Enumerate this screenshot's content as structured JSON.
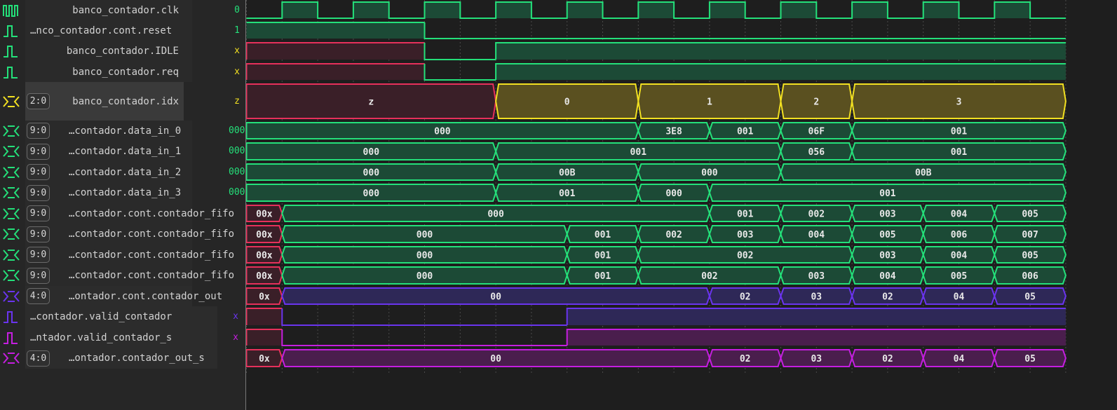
{
  "colors": {
    "green": "#24e07a",
    "green_fill": "#1c4a36",
    "red": "#e6305b",
    "red_fill": "#3a1f28",
    "yellow": "#f2e021",
    "yellow_fill": "#5a5020",
    "violet": "#6a34ee",
    "violet_fill": "#2e2857",
    "magenta": "#c51ee0",
    "magenta_fill": "#4a1e4d",
    "grid": "#4a4a4a"
  },
  "signals": [
    {
      "name": "banco_contador.clk",
      "width": "",
      "value": "0",
      "icon": "clock-icon",
      "style": "clock"
    },
    {
      "name": "…nco_contador.cont.reset",
      "width": "",
      "value": "1",
      "icon": "bit-wave-icon",
      "style": "bit"
    },
    {
      "name": "banco_contador.IDLE",
      "width": "",
      "value": "x",
      "icon": "bit-wave-icon",
      "style": "bit"
    },
    {
      "name": "banco_contador.req",
      "width": "",
      "value": "x",
      "icon": "bit-wave-icon",
      "style": "bit"
    },
    {
      "name": "banco_contador.idx",
      "width": "2:0",
      "value": "z",
      "icon": "bus-wave-icon",
      "style": "bus"
    },
    {
      "name": "…contador.data_in_0",
      "width": "9:0",
      "value": "000",
      "icon": "bus-wave-icon",
      "style": "bus"
    },
    {
      "name": "…contador.data_in_1",
      "width": "9:0",
      "value": "000",
      "icon": "bus-wave-icon",
      "style": "bus"
    },
    {
      "name": "…contador.data_in_2",
      "width": "9:0",
      "value": "000",
      "icon": "bus-wave-icon",
      "style": "bus"
    },
    {
      "name": "…contador.data_in_3",
      "width": "9:0",
      "value": "000",
      "icon": "bus-wave-icon",
      "style": "bus"
    },
    {
      "name": "…contador.cont.contador_fifo",
      "width": "9:0",
      "value": "",
      "icon": "bus-wave-icon",
      "style": "bus"
    },
    {
      "name": "…contador.cont.contador_fifo",
      "width": "9:0",
      "value": "",
      "icon": "bus-wave-icon",
      "style": "bus"
    },
    {
      "name": "…contador.cont.contador_fifo",
      "width": "9:0",
      "value": "",
      "icon": "bus-wave-icon",
      "style": "bus"
    },
    {
      "name": "…contador.cont.contador_fifo",
      "width": "9:0",
      "value": "",
      "icon": "bus-wave-icon",
      "style": "bus"
    },
    {
      "name": "…ontador.cont.contador_out",
      "width": "4:0",
      "value": "",
      "icon": "bus-wave-icon",
      "style": "bus"
    },
    {
      "name": "…contador.valid_contador",
      "width": "",
      "value": "x",
      "icon": "bit-wave-icon",
      "style": "bit"
    },
    {
      "name": "…ntador.valid_contador_s",
      "width": "",
      "value": "x",
      "icon": "bit-wave-icon",
      "style": "bit"
    },
    {
      "name": "…ontador.contador_out_s",
      "width": "4:0",
      "value": "",
      "icon": "bus-wave-icon",
      "style": "bus"
    }
  ],
  "waves": [
    {
      "kind": "clock",
      "color": "green",
      "start": 0,
      "end": 23,
      "half_period": 1
    },
    {
      "kind": "bit",
      "color": "green",
      "segs": [
        [
          0,
          5,
          "1"
        ],
        [
          5,
          23,
          "0"
        ]
      ]
    },
    {
      "kind": "bit",
      "color": "green",
      "segs": [
        [
          0,
          5,
          "x"
        ],
        [
          5,
          7,
          "0"
        ],
        [
          7,
          23,
          "1"
        ]
      ]
    },
    {
      "kind": "bit",
      "color": "green",
      "segs": [
        [
          0,
          5,
          "x"
        ],
        [
          5,
          7,
          "0"
        ],
        [
          7,
          23,
          "1"
        ]
      ]
    },
    {
      "kind": "bus",
      "color": "yellow",
      "segs": [
        [
          0,
          7,
          "z",
          "z"
        ],
        [
          7,
          11,
          "0"
        ],
        [
          11,
          15,
          "1"
        ],
        [
          15,
          17,
          "2"
        ],
        [
          17,
          23,
          "3"
        ]
      ]
    },
    {
      "kind": "bus",
      "color": "green",
      "segs": [
        [
          0,
          11,
          "000"
        ],
        [
          11,
          13,
          "3E8"
        ],
        [
          13,
          15,
          "001"
        ],
        [
          15,
          17,
          "06F"
        ],
        [
          17,
          23,
          "001"
        ]
      ]
    },
    {
      "kind": "bus",
      "color": "green",
      "segs": [
        [
          0,
          7,
          "000"
        ],
        [
          7,
          15,
          "001"
        ],
        [
          15,
          17,
          "056"
        ],
        [
          17,
          23,
          "001"
        ]
      ]
    },
    {
      "kind": "bus",
      "color": "green",
      "segs": [
        [
          0,
          7,
          "000"
        ],
        [
          7,
          11,
          "00B"
        ],
        [
          11,
          15,
          "000"
        ],
        [
          15,
          23,
          "00B"
        ]
      ]
    },
    {
      "kind": "bus",
      "color": "green",
      "segs": [
        [
          0,
          7,
          "000"
        ],
        [
          7,
          11,
          "001"
        ],
        [
          11,
          13,
          "000"
        ],
        [
          13,
          23,
          "001"
        ]
      ]
    },
    {
      "kind": "bus",
      "color": "green",
      "segs": [
        [
          0,
          1,
          "00x",
          "x"
        ],
        [
          1,
          13,
          "000"
        ],
        [
          13,
          15,
          "001"
        ],
        [
          15,
          17,
          "002"
        ],
        [
          17,
          19,
          "003"
        ],
        [
          19,
          21,
          "004"
        ],
        [
          21,
          23,
          "005"
        ]
      ]
    },
    {
      "kind": "bus",
      "color": "green",
      "segs": [
        [
          0,
          1,
          "00x",
          "x"
        ],
        [
          1,
          9,
          "000"
        ],
        [
          9,
          11,
          "001"
        ],
        [
          11,
          13,
          "002"
        ],
        [
          13,
          15,
          "003"
        ],
        [
          15,
          17,
          "004"
        ],
        [
          17,
          19,
          "005"
        ],
        [
          19,
          21,
          "006"
        ],
        [
          21,
          23,
          "007"
        ]
      ]
    },
    {
      "kind": "bus",
      "color": "green",
      "segs": [
        [
          0,
          1,
          "00x",
          "x"
        ],
        [
          1,
          9,
          "000"
        ],
        [
          9,
          11,
          "001"
        ],
        [
          11,
          17,
          "002"
        ],
        [
          17,
          19,
          "003"
        ],
        [
          19,
          21,
          "004"
        ],
        [
          21,
          23,
          "005"
        ]
      ]
    },
    {
      "kind": "bus",
      "color": "green",
      "segs": [
        [
          0,
          1,
          "00x",
          "x"
        ],
        [
          1,
          9,
          "000"
        ],
        [
          9,
          11,
          "001"
        ],
        [
          11,
          15,
          "002"
        ],
        [
          15,
          17,
          "003"
        ],
        [
          17,
          19,
          "004"
        ],
        [
          19,
          21,
          "005"
        ],
        [
          21,
          23,
          "006"
        ]
      ]
    },
    {
      "kind": "bus",
      "color": "violet",
      "segs": [
        [
          0,
          1,
          "0x",
          "x"
        ],
        [
          1,
          13,
          "00"
        ],
        [
          13,
          15,
          "02"
        ],
        [
          15,
          17,
          "03"
        ],
        [
          17,
          19,
          "02"
        ],
        [
          19,
          21,
          "04"
        ],
        [
          21,
          23,
          "05"
        ]
      ]
    },
    {
      "kind": "bit",
      "color": "violet",
      "segs": [
        [
          0,
          1,
          "x"
        ],
        [
          1,
          9,
          "0"
        ],
        [
          9,
          23,
          "1"
        ]
      ]
    },
    {
      "kind": "bit",
      "color": "magenta",
      "segs": [
        [
          0,
          1,
          "x"
        ],
        [
          1,
          9,
          "0"
        ],
        [
          9,
          23,
          "1"
        ]
      ]
    },
    {
      "kind": "bus",
      "color": "magenta",
      "segs": [
        [
          0,
          1,
          "0x",
          "x"
        ],
        [
          1,
          13,
          "00"
        ],
        [
          13,
          15,
          "02"
        ],
        [
          15,
          17,
          "03"
        ],
        [
          17,
          19,
          "02"
        ],
        [
          19,
          21,
          "04"
        ],
        [
          21,
          23,
          "05"
        ]
      ]
    }
  ]
}
